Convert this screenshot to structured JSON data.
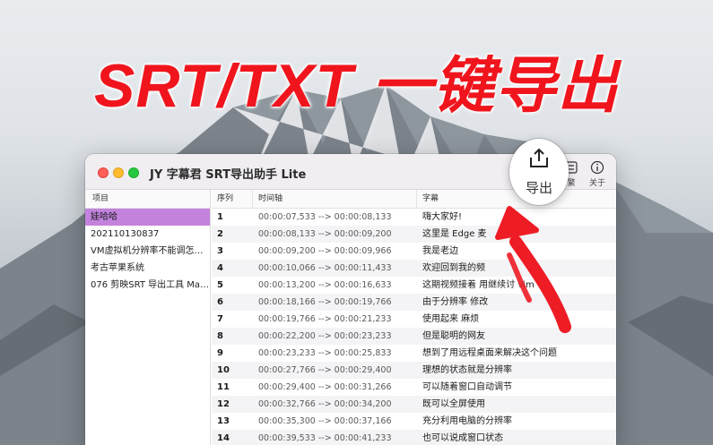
{
  "headline": "SRT/TXT 一键导出",
  "window": {
    "title": "JY 字幕君 SRT导出助手 Lite",
    "toolbar": {
      "share_label": "导",
      "merge_label": "繁",
      "about_label": "关于",
      "export_label": "导出"
    }
  },
  "sidebar": {
    "header": "项目",
    "items": [
      "娃哈哈",
      "202110130837",
      "VM虚拟机分辨率不能调怎么…",
      "考古苹果系统",
      "076 剪映SRT 导出工具 Mac…"
    ]
  },
  "table": {
    "headers": [
      "序列",
      "时间轴",
      "字幕"
    ],
    "rows": [
      [
        "1",
        "00:00:07,533 --> 00:00:08,133",
        "嗨大家好!"
      ],
      [
        "2",
        "00:00:08,133 --> 00:00:09,200",
        "这里是 Edge 麦"
      ],
      [
        "3",
        "00:00:09,200 --> 00:00:09,966",
        "我是老边"
      ],
      [
        "4",
        "00:00:10,066 --> 00:00:11,433",
        "欢迎回到我的频"
      ],
      [
        "5",
        "00:00:13,200 --> 00:00:16,633",
        "这期视频接着 用继续讨 vim"
      ],
      [
        "6",
        "00:00:18,166 --> 00:00:19,766",
        "由于分辨率 修改"
      ],
      [
        "7",
        "00:00:19,766 --> 00:00:21,233",
        "使用起来 麻烦"
      ],
      [
        "8",
        "00:00:22,200 --> 00:00:23,233",
        "但是聪明的网友"
      ],
      [
        "9",
        "00:00:23,233 --> 00:00:25,833",
        "想到了用远程桌面来解决这个问题"
      ],
      [
        "10",
        "00:00:27,766 --> 00:00:29,400",
        "理想的状态就是分辨率"
      ],
      [
        "11",
        "00:00:29,400 --> 00:00:31,266",
        "可以随着窗口自动调节"
      ],
      [
        "12",
        "00:00:32,766 --> 00:00:34,200",
        "既可以全屏使用"
      ],
      [
        "13",
        "00:00:35,300 --> 00:00:37,166",
        "充分利用电脑的分辨率"
      ],
      [
        "14",
        "00:00:39,533 --> 00:00:41,233",
        "也可以说成窗口状态"
      ]
    ]
  },
  "colors": {
    "accent_red": "#f0151d",
    "selection": "#c383dd"
  }
}
